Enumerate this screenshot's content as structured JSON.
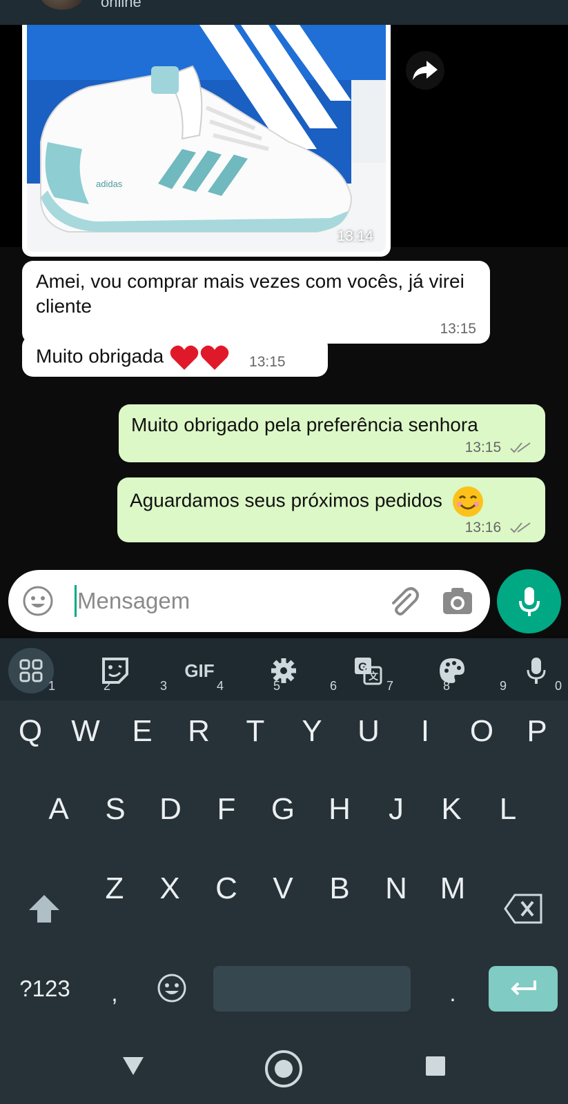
{
  "header": {
    "status": "online"
  },
  "chat": {
    "image_message": {
      "time": "13:14",
      "photo": "white and light-blue adidas sneaker on blue shoebox"
    },
    "messages": [
      {
        "direction": "in",
        "text": "Amei, vou comprar mais vezes com vocês, já virei cliente",
        "time": "13:15"
      },
      {
        "direction": "in",
        "text": "Muito obrigada",
        "emoji": "❤️❤️",
        "time": "13:15"
      },
      {
        "direction": "out",
        "text": "Muito obrigado pela preferência senhora",
        "time": "13:15",
        "status": "read"
      },
      {
        "direction": "out",
        "text": "Aguardamos seus próximos pedidos",
        "emoji": "😊",
        "time": "13:16",
        "status": "read"
      }
    ]
  },
  "composer": {
    "placeholder": "Mensagem",
    "icons": [
      "emoji-icon",
      "paperclip-icon",
      "camera-icon",
      "microphone-icon"
    ]
  },
  "keyboard": {
    "toolbar": [
      "apps-grid-icon",
      "sticker-icon",
      "GIF",
      "gear-icon",
      "translate-icon",
      "palette-icon",
      "microphone-icon"
    ],
    "row1": [
      {
        "k": "Q",
        "h": "1"
      },
      {
        "k": "W",
        "h": "2"
      },
      {
        "k": "E",
        "h": "3"
      },
      {
        "k": "R",
        "h": "4"
      },
      {
        "k": "T",
        "h": "5"
      },
      {
        "k": "Y",
        "h": "6"
      },
      {
        "k": "U",
        "h": "7"
      },
      {
        "k": "I",
        "h": "8"
      },
      {
        "k": "O",
        "h": "9"
      },
      {
        "k": "P",
        "h": "0"
      }
    ],
    "row2": [
      "A",
      "S",
      "D",
      "F",
      "G",
      "H",
      "J",
      "K",
      "L"
    ],
    "row3": [
      "Z",
      "X",
      "C",
      "V",
      "B",
      "N",
      "M"
    ],
    "row4": {
      "symbols": "?123",
      "comma": ",",
      "period": "."
    }
  },
  "colors": {
    "accent": "#00a884",
    "outgoing": "#dcf8c6",
    "incoming": "#ffffff",
    "keyboard_bg": "#263238"
  }
}
